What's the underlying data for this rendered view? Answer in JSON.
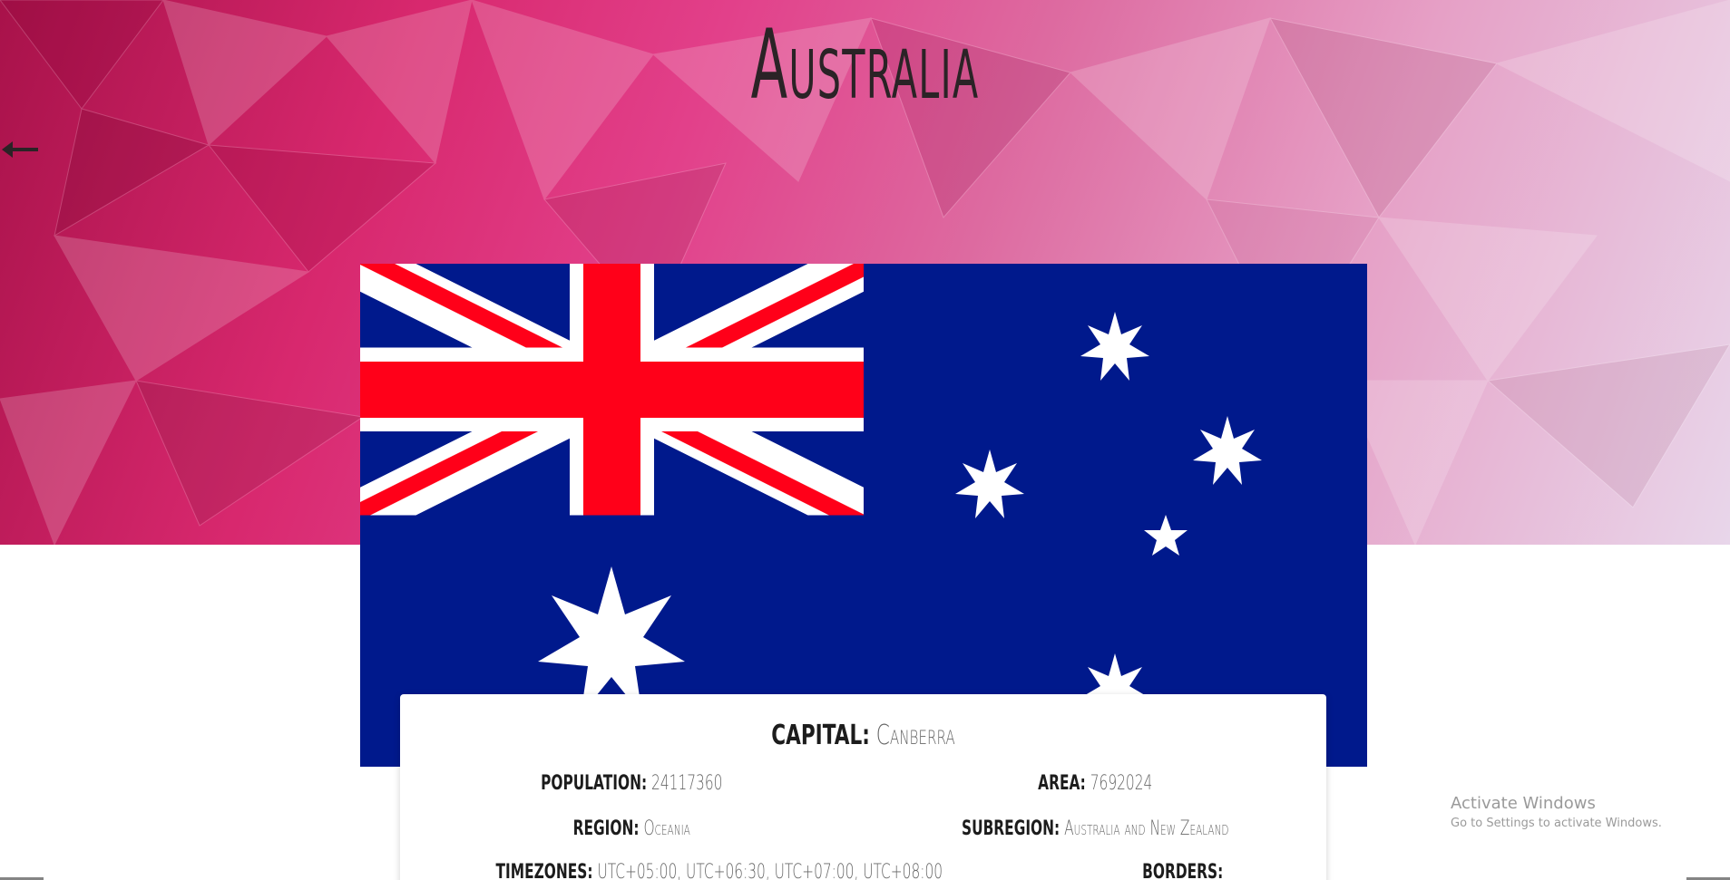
{
  "header": {
    "country_name": "Australia",
    "back_icon": "arrow-left-icon"
  },
  "flag": {
    "colors": {
      "blue": "#00198c",
      "red": "#ff0019",
      "white": "#ffffff"
    }
  },
  "details": {
    "capital_label": "CAPITAL:",
    "capital_value": "Canberra",
    "population_label": "POPULATION:",
    "population_value": "24117360",
    "area_label": "AREA:",
    "area_value": "7692024",
    "region_label": "REGION:",
    "region_value": "Oceania",
    "subregion_label": "SUBREGION:",
    "subregion_value": "Australia and New Zealand",
    "timezones_label": "TIMEZONES:",
    "timezones_value": "UTC+05:00, UTC+06:30, UTC+07:00, UTC+08:00",
    "borders_label": "BORDERS:",
    "borders_value": ""
  },
  "os_overlay": {
    "title": "Activate Windows",
    "subtitle": "Go to Settings to activate Windows."
  }
}
